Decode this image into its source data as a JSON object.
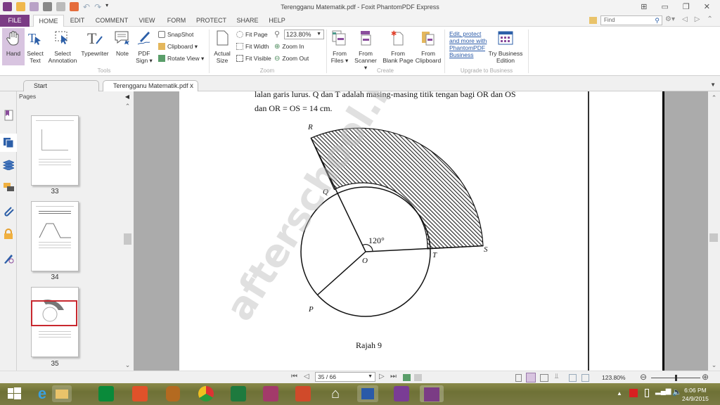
{
  "window": {
    "title": "Terengganu Matematik.pdf - Foxit PhantomPDF Express",
    "controls": [
      "restore-layout",
      "minimize",
      "maximize",
      "close"
    ]
  },
  "menu": [
    "FILE",
    "HOME",
    "EDIT",
    "COMMENT",
    "VIEW",
    "FORM",
    "PROTECT",
    "SHARE",
    "HELP"
  ],
  "find": {
    "placeholder": "Find"
  },
  "ribbon": {
    "tools": {
      "group_label": "Tools",
      "hand": "Hand",
      "select_text": [
        "Select",
        "Text"
      ],
      "select_annotation": [
        "Select",
        "Annotation"
      ],
      "typewriter": "Typewriter",
      "note": "Note",
      "pdf_sign": [
        "PDF",
        "Sign ▾"
      ],
      "snapshot": "SnapShot",
      "clipboard": "Clipboard ▾",
      "rotate_view": "Rotate View ▾"
    },
    "zoom": {
      "group_label": "Zoom",
      "actual_size": [
        "Actual",
        "Size"
      ],
      "fit_page": "Fit Page",
      "fit_width": "Fit Width",
      "fit_visible": "Fit Visible",
      "zoom_value": "123.80%",
      "zoom_in": "Zoom In",
      "zoom_out": "Zoom Out"
    },
    "create": {
      "group_label": "Create",
      "from_files": [
        "From",
        "Files ▾"
      ],
      "from_scanner": [
        "From",
        "Scanner ▾"
      ],
      "from_blank": [
        "From",
        "Blank Page"
      ],
      "from_clipboard": [
        "From",
        "Clipboard"
      ]
    },
    "upgrade": {
      "group_label": "Upgrade to Business",
      "link": "Edit, protect and more with PhantomPDF Business",
      "try_business": [
        "Try Business",
        "Edition"
      ]
    }
  },
  "tabs": [
    {
      "label": "Start"
    },
    {
      "label": "Terengganu Matematik.pdf",
      "close": "x"
    }
  ],
  "pages_panel": {
    "title": "Pages",
    "thumbnails": [
      {
        "label": "33"
      },
      {
        "label": "34"
      },
      {
        "label": "35"
      }
    ]
  },
  "document": {
    "line1": "lalan garis lurus. Q dan T adalah masing-masing titik tengan bagi OR dan OS",
    "line2": "dan OR = OS = 14 cm.",
    "watermark": "afterschool.m",
    "figure": {
      "labels": {
        "R": "R",
        "Q": "Q",
        "O": "O",
        "T": "T",
        "S": "S",
        "P": "P"
      },
      "angle": "120°",
      "caption": "Rajah 9"
    }
  },
  "statusbar": {
    "page_indicator": "35 / 66",
    "zoom_value": "123.80%",
    "zoom_slider_fraction": 0.5
  },
  "taskbar": {
    "time": "6:06 PM",
    "date": "24/9/2015"
  }
}
